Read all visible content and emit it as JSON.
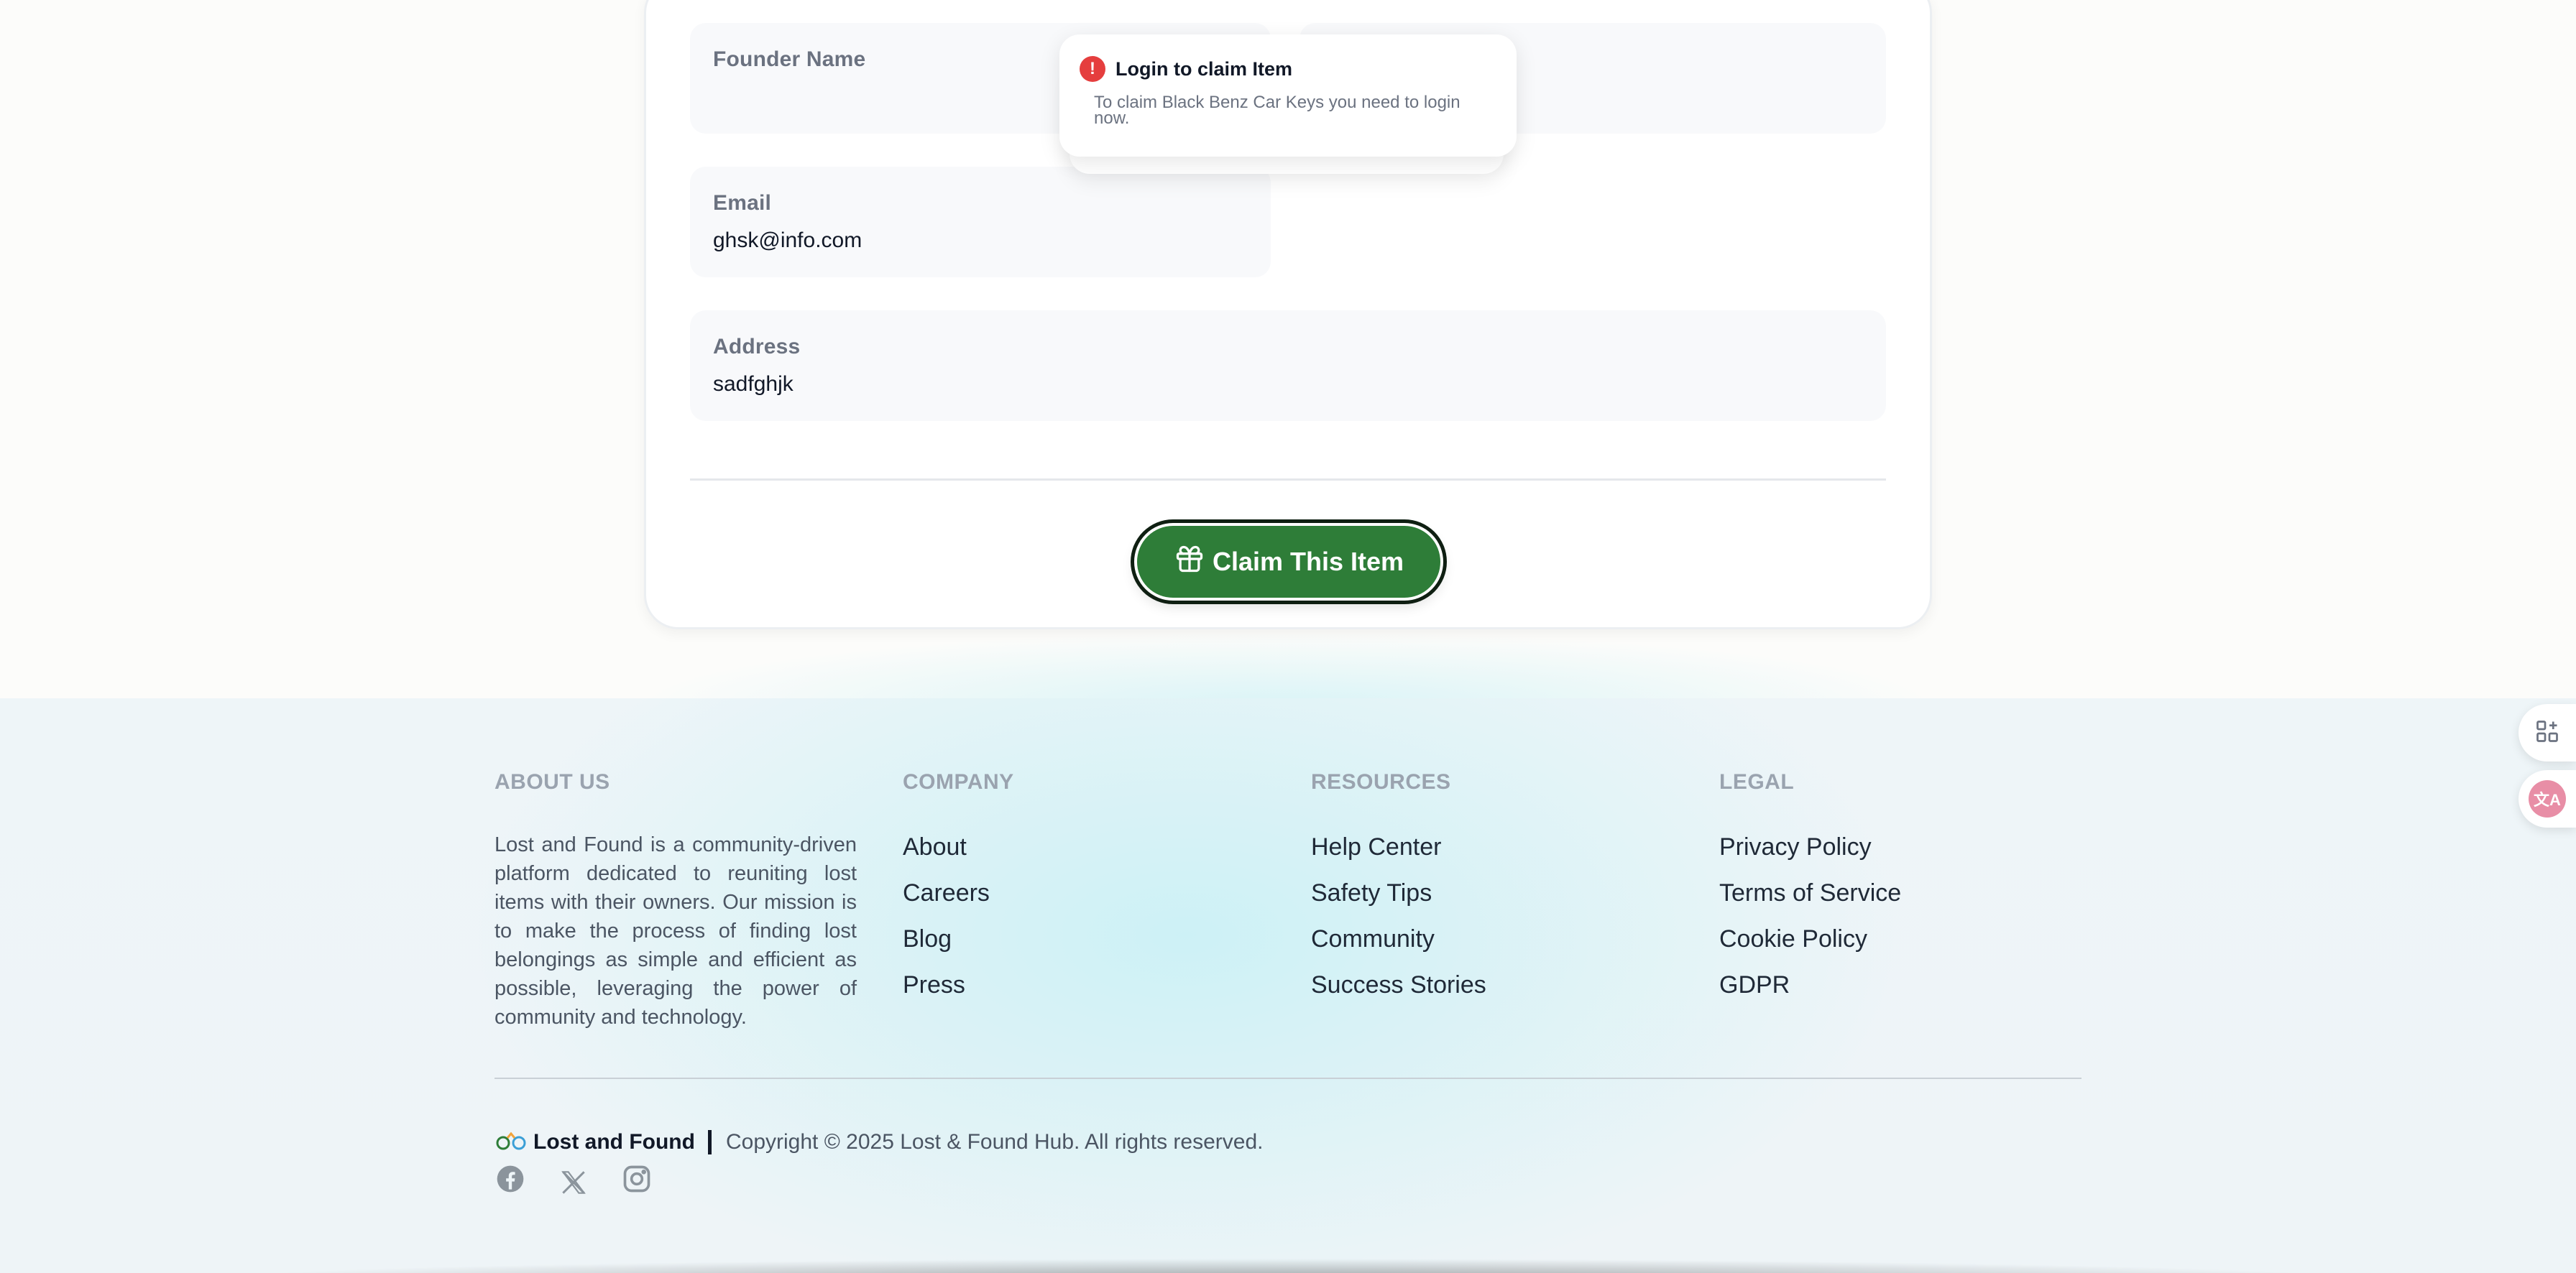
{
  "form": {
    "founder_label": "Founder Name",
    "founder_value": "",
    "email_label": "Email",
    "email_value": "ghsk@info.com",
    "address_label": "Address",
    "address_value": "sadfghjk",
    "claim_button_label": "Claim This Item"
  },
  "toast": {
    "title": "Login to claim Item",
    "message": "To claim Black Benz Car Keys you need to login now."
  },
  "footer": {
    "about": {
      "heading": "ABOUT US",
      "text": "Lost and Found is a community-driven platform dedicated to reuniting lost items with their owners. Our mission is to make the process of finding lost belongings as simple and efficient as possible, leveraging the power of community and technology."
    },
    "company": {
      "heading": "COMPANY",
      "links": [
        "About",
        "Careers",
        "Blog",
        "Press"
      ]
    },
    "resources": {
      "heading": "RESOURCES",
      "links": [
        "Help Center",
        "Safety Tips",
        "Community",
        "Success Stories"
      ]
    },
    "legal": {
      "heading": "LEGAL",
      "links": [
        "Privacy Policy",
        "Terms of Service",
        "Cookie Policy",
        "GDPR"
      ]
    },
    "brand_name": "Lost and Found",
    "copyright": "Copyright © 2025 Lost & Found Hub. All rights reserved.",
    "socials": [
      "facebook-icon",
      "x-icon",
      "instagram-icon"
    ]
  },
  "floating": {
    "translate_label": "文A"
  },
  "colors": {
    "accent_green": "#2e7d38",
    "error_red": "#e53e3e"
  }
}
